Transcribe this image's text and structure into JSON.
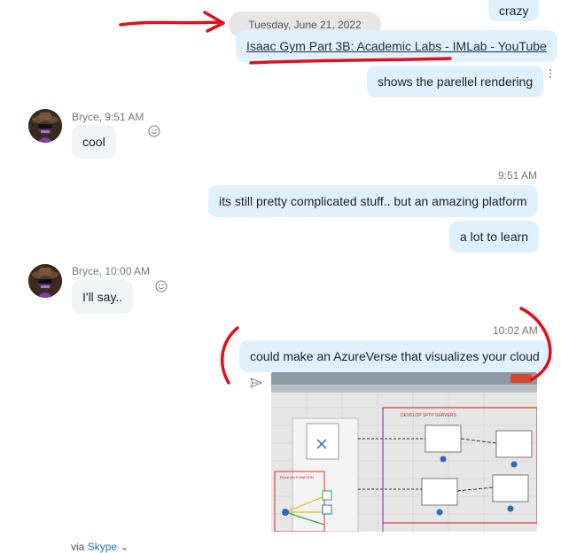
{
  "messages": {
    "m1": "crazy",
    "m2_link": "Isaac Gym Part 3B: Academic Labs - IMLab - YouTube",
    "m3": "shows the parellel rendering",
    "m4": "cool",
    "m5": "its still pretty complicated stuff..  but an amazing platform",
    "m6": "a lot to learn",
    "m7": "I'll say..",
    "m8": "could make an AzureVerse that visualizes your cloud"
  },
  "date_divider": "Tuesday, June 21, 2022",
  "senders": {
    "bryce_951": "Bryce, 9:51 AM",
    "bryce_1000": "Bryce, 10:00 AM"
  },
  "timestamps": {
    "t951": "9:51 AM",
    "t1002": "10:02 AM"
  },
  "footer": {
    "via": "via",
    "app": "Skype",
    "chevron": "⌄"
  },
  "photo_text": {
    "title": "DEVELOP SFTP SERVERS",
    "sub": "RULE AUTOMATION"
  },
  "icons": {
    "react": "smiley-icon",
    "send": "send-icon",
    "more": "more-options-icon"
  },
  "colors": {
    "bubble_out": "#dff1ff",
    "bubble_in": "#f1f3f5",
    "annotation": "#e0101a",
    "link_accent": "#1a73c8"
  }
}
